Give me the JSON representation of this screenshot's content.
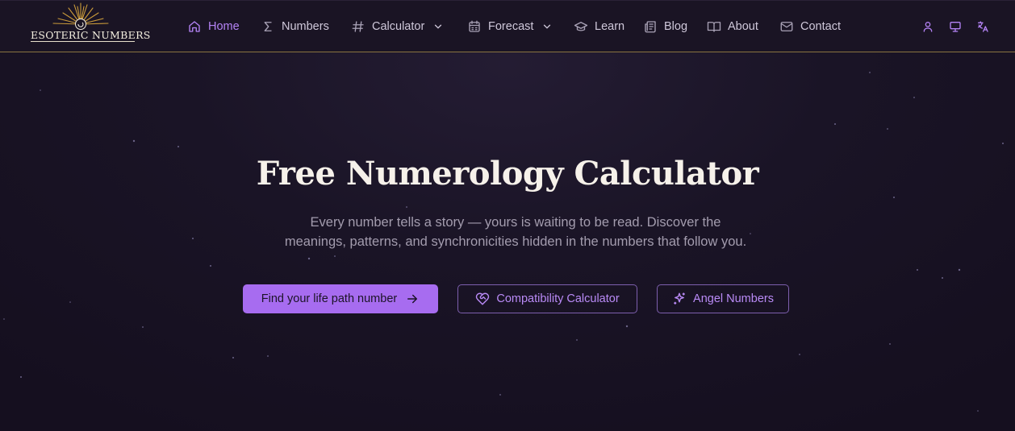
{
  "brand": {
    "name": "ESOTERIC NUMBERS"
  },
  "nav": {
    "items": [
      {
        "label": "Home",
        "icon": "home-icon",
        "active": true
      },
      {
        "label": "Numbers",
        "icon": "sigma-icon"
      },
      {
        "label": "Calculator",
        "icon": "hash-icon",
        "dropdown": true
      },
      {
        "label": "Forecast",
        "icon": "calendar-icon",
        "dropdown": true
      },
      {
        "label": "Learn",
        "icon": "graduation-cap-icon"
      },
      {
        "label": "Blog",
        "icon": "newspaper-icon"
      },
      {
        "label": "About",
        "icon": "book-open-icon"
      },
      {
        "label": "Contact",
        "icon": "mail-icon"
      }
    ],
    "utility": [
      {
        "icon": "user-icon"
      },
      {
        "icon": "monitor-icon"
      },
      {
        "icon": "translate-icon"
      }
    ]
  },
  "hero": {
    "title": "Free Numerology Calculator",
    "subtitle_line1": "Every number tells a story — yours is waiting to be read. Discover the",
    "subtitle_line2": "meanings, patterns, and synchronicities hidden in the numbers that follow you.",
    "buttons": {
      "primary": {
        "label": "Find your life path number",
        "icon": "arrow-right-icon"
      },
      "compatibility": {
        "label": "Compatibility Calculator",
        "icon": "heart-handshake-icon"
      },
      "angel": {
        "label": "Angel Numbers",
        "icon": "sparkles-icon"
      }
    }
  },
  "colors": {
    "accent": "#b483f5",
    "button_fill": "#a76cf0",
    "header_border": "#8a7440",
    "background": "#150f1f"
  }
}
